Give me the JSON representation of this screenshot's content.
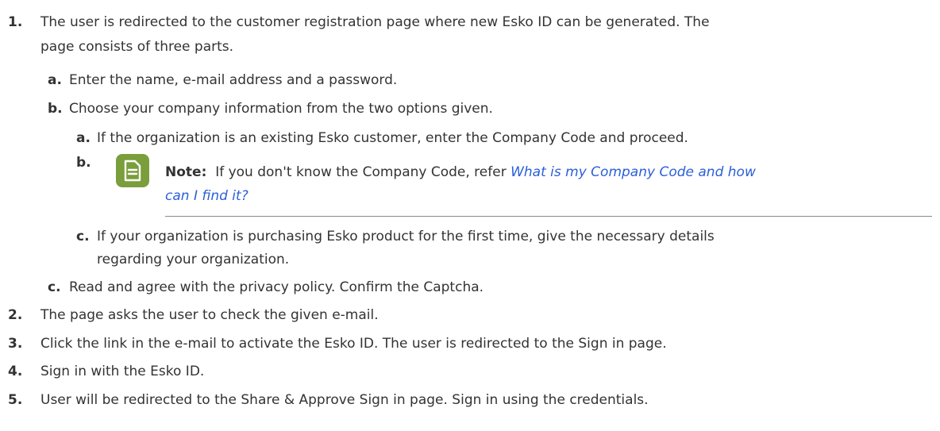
{
  "steps": [
    {
      "number": "1.",
      "text_line1": "The user is redirected to the customer registration page where new Esko ID can be generated. The",
      "text_line2": "page consists of three parts.",
      "substeps": [
        {
          "letter": "a.",
          "text": "Enter the name, e-mail address and a password."
        },
        {
          "letter": "b.",
          "text": "Choose your company information from the two options given."
        },
        {
          "letter": "c.",
          "text": "Read and agree with the privacy policy. Confirm the Captcha."
        }
      ],
      "nested": [
        {
          "letter": "a.",
          "text": "If the organization is an existing Esko customer, enter the Company Code and proceed."
        },
        {
          "letter": "b."
        },
        {
          "letter": "c.",
          "text_line1": "If your organization is purchasing Esko product for the first time, give the necessary details",
          "text_line2": "regarding your organization."
        }
      ],
      "note": {
        "label": "Note:",
        "text": "If you don't know the Company Code, refer",
        "link_line1": "What is my Company Code and how",
        "link_line2": "can I find it?"
      }
    },
    {
      "number": "2.",
      "text": "The page asks the user to check the given e-mail."
    },
    {
      "number": "3.",
      "text": "Click the link in the e-mail to activate the Esko ID. The user is redirected to the Sign in page."
    },
    {
      "number": "4.",
      "text": "Sign in with the Esko ID."
    },
    {
      "number": "5.",
      "text": "User will be redirected to the Share & Approve Sign in page. Sign in using the credentials."
    }
  ],
  "icons": {
    "note": "note-document-icon"
  },
  "colors": {
    "text": "#333333",
    "link": "#2b5fd9",
    "note_icon_bg": "#7a9e3b"
  }
}
